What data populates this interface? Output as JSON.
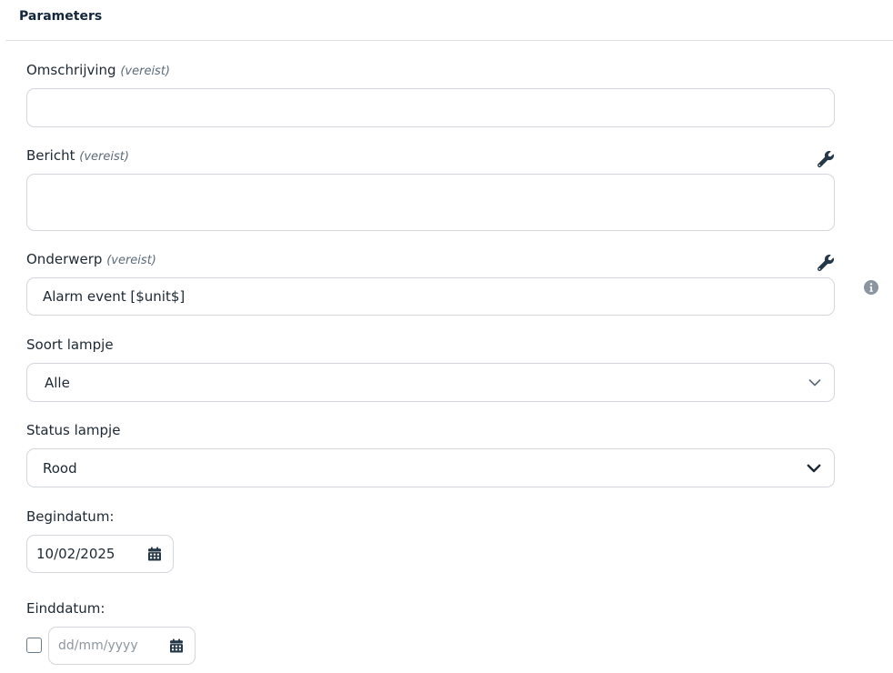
{
  "header": {
    "title": "Parameters"
  },
  "required_hint": "(vereist)",
  "fields": {
    "omschrijving": {
      "label": "Omschrijving",
      "value": ""
    },
    "bericht": {
      "label": "Bericht",
      "value": "",
      "tool_icon": "wrench-icon"
    },
    "onderwerp": {
      "label": "Onderwerp",
      "value": "Alarm event [$unit$]",
      "tool_icon": "wrench-icon",
      "help_icon": "info-icon"
    },
    "soort_lampje": {
      "label": "Soort lampje",
      "selected": "Alle",
      "icon": "chevron-down-icon"
    },
    "status_lampje": {
      "label": "Status lampje",
      "selected": "Rood",
      "icon": "chevron-down-icon"
    },
    "begindatum": {
      "label": "Begindatum:",
      "value": "10/02/2025",
      "icon": "calendar-icon"
    },
    "einddatum": {
      "label": "Einddatum:",
      "placeholder": "dd/mm/yyyy",
      "checked": false,
      "icon": "calendar-icon"
    }
  },
  "colors": {
    "icon": "#243746",
    "border": "#d3d7dc",
    "info": "#8a959f"
  }
}
